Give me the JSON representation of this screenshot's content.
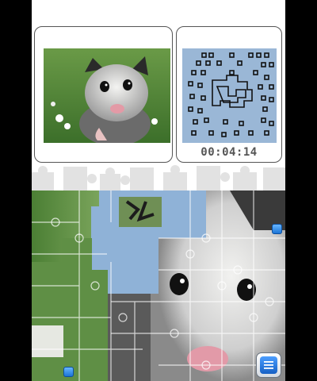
{
  "top_screen": {
    "reference_image": "baby-opossum-photo",
    "timer": "00:04:14"
  },
  "bottom_screen": {
    "board_image": "baby-opossum-photo",
    "menu_button": "menu-list-icon"
  },
  "colors": {
    "board_background": "#8fb2d7",
    "minimap_background": "#9ab7d6",
    "handle_blue": "#2a8cf0"
  }
}
